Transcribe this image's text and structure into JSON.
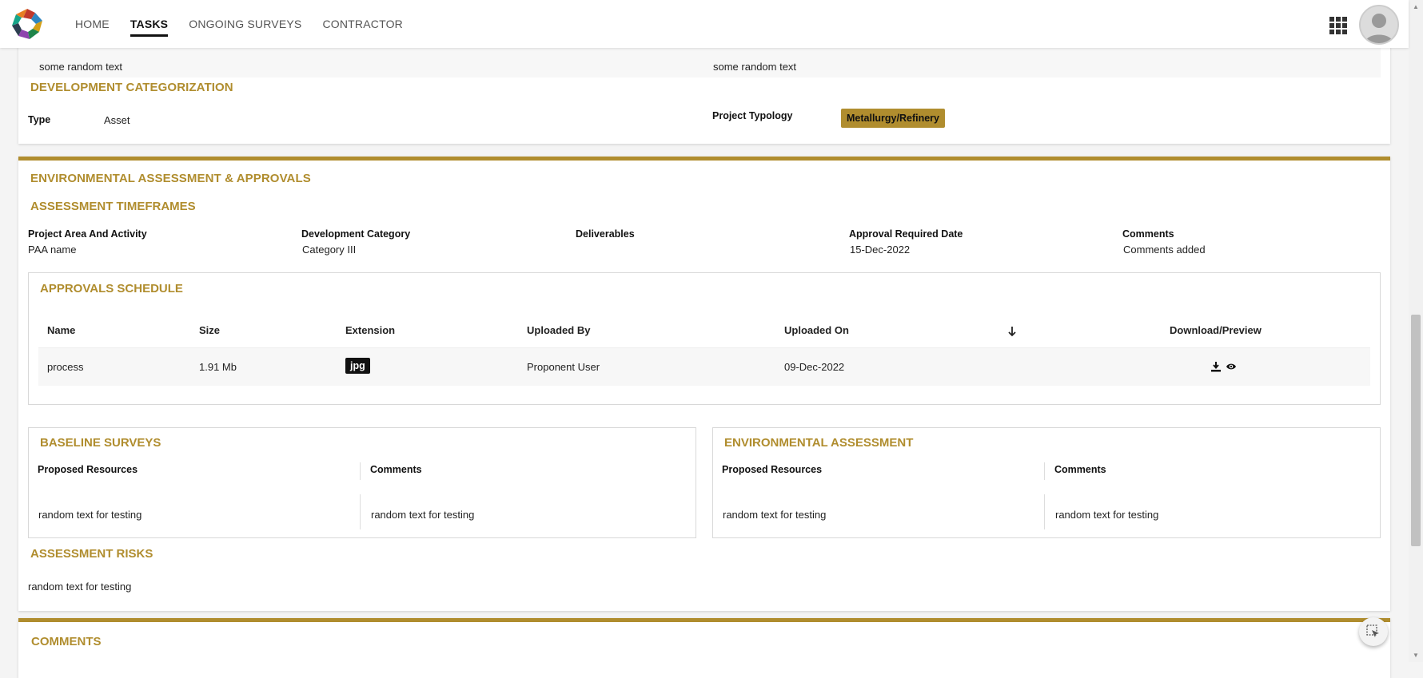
{
  "nav": {
    "items": [
      "HOME",
      "TASKS",
      "ONGOING SURVEYS",
      "CONTRACTOR"
    ],
    "active": "TASKS"
  },
  "icons": {
    "apps": "apps-grid-icon",
    "avatar": "user-avatar-icon",
    "download": "download-icon",
    "preview": "eye-icon",
    "sort": "arrow-down-icon",
    "fab": "cursor-select-icon"
  },
  "colors": {
    "accent": "#b08d2e",
    "ext_badge": "#111111"
  },
  "top_section": {
    "left_text": "some random text",
    "right_text": "some random text",
    "dev_cat_title": "DEVELOPMENT CATEGORIZATION",
    "type_label": "Type",
    "type_value": "Asset",
    "typology_label": "Project Typology",
    "typology_value": "Metallurgy/Refinery"
  },
  "env": {
    "title": "ENVIRONMENTAL ASSESSMENT & APPROVALS",
    "timeframes_title": "ASSESSMENT TIMEFRAMES",
    "timeframes": {
      "labels": [
        "Project Area And Activity",
        "Development Category",
        "Deliverables",
        "Approval Required Date",
        "Comments"
      ],
      "values": [
        "PAA name",
        "Category III",
        "",
        "15-Dec-2022",
        "Comments added"
      ]
    },
    "approvals": {
      "title": "APPROVALS SCHEDULE",
      "headers": [
        "Name",
        "Size",
        "Extension",
        "Uploaded By",
        "Uploaded On",
        "Download/Preview"
      ],
      "rows": [
        {
          "name": "process",
          "size": "1.91 Mb",
          "ext": "jpg",
          "by": "Proponent User",
          "on": "09-Dec-2022"
        }
      ]
    },
    "baseline": {
      "title": "BASELINE SURVEYS",
      "col1": "Proposed Resources",
      "col2": "Comments",
      "val1": "random text for testing",
      "val2": "random text for testing"
    },
    "envassess": {
      "title": "ENVIRONMENTAL ASSESSMENT",
      "col1": "Proposed Resources",
      "col2": "Comments",
      "val1": "random text for testing",
      "val2": "random text for testing"
    },
    "risks_title": "ASSESSMENT RISKS",
    "risks_value": "random text for testing"
  },
  "comments": {
    "title": "COMMENTS"
  }
}
